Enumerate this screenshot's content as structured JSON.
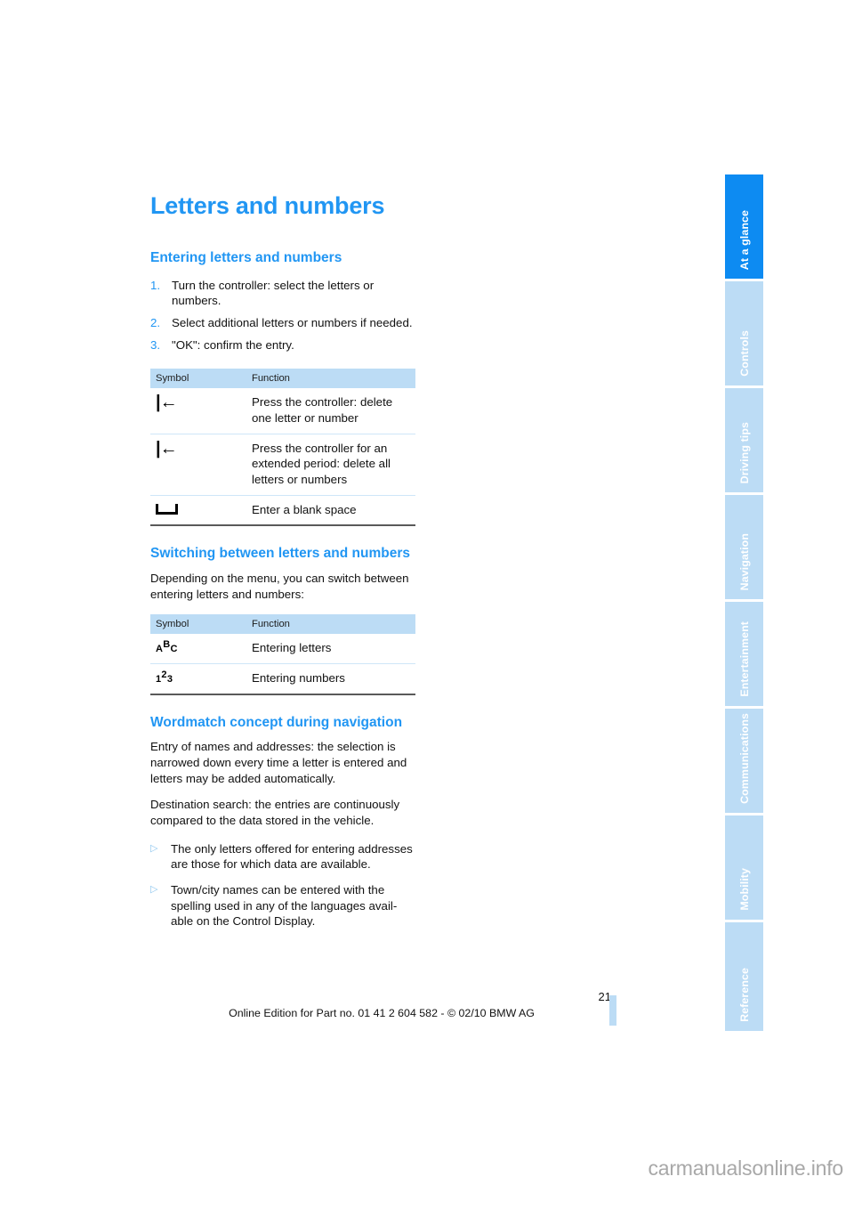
{
  "document": {
    "chapter_title": "Letters and numbers",
    "page_number": "21",
    "edition_line": "Online Edition for Part no. 01 41 2 604 582 - © 02/10 BMW AG",
    "watermark": "carmanualsonline.info",
    "accent_color": "#2196f3",
    "tab_active_color": "#0d8bf2",
    "tab_inactive_color": "#bcdcf5",
    "table_header_color": "#bcdcf5"
  },
  "section_entering": {
    "heading": "Entering letters and numbers",
    "steps": [
      {
        "num": "1.",
        "text": "Turn the controller: select the letters or numbers."
      },
      {
        "num": "2.",
        "text": "Select additional letters or numbers if needed."
      },
      {
        "num": "3.",
        "text": "\"OK\": confirm the entry."
      }
    ],
    "table": {
      "headers": {
        "symbol": "Symbol",
        "function": "Function"
      },
      "rows": [
        {
          "symbol_icon": "backspace-icon",
          "function": "Press the controller: delete one letter or number"
        },
        {
          "symbol_icon": "backspace-icon",
          "function": "Press the controller for an extended period: delete all letters or numbers"
        },
        {
          "symbol_icon": "blank-space-icon",
          "function": "Enter a blank space"
        }
      ]
    }
  },
  "section_switching": {
    "heading": "Switching between letters and numbers",
    "intro": "Depending on the menu, you can switch between entering letters and numbers:",
    "table": {
      "headers": {
        "symbol": "Symbol",
        "function": "Function"
      },
      "rows": [
        {
          "symbol_icon": "abc-icon",
          "symbol_text": "ABC",
          "function": "Entering letters"
        },
        {
          "symbol_icon": "123-icon",
          "symbol_text": "123",
          "function": "Entering numbers"
        }
      ]
    }
  },
  "section_wordmatch": {
    "heading": "Wordmatch concept during navigation",
    "paragraphs": [
      "Entry of names and addresses: the selection is narrowed down every time a letter is entered and letters may be added automatically.",
      "Destination search: the entries are continuously compared to the data stored in the vehicle."
    ],
    "bullets": [
      "The only letters offered for entering addresses are those for which data are available.",
      "Town/city names can be entered with the spelling used in any of the languages avail-able on the Control Display."
    ]
  },
  "rail": {
    "tabs": [
      {
        "label": "At a glance",
        "active": true
      },
      {
        "label": "Controls",
        "active": false
      },
      {
        "label": "Driving tips",
        "active": false
      },
      {
        "label": "Navigation",
        "active": false
      },
      {
        "label": "Entertainment",
        "active": false
      },
      {
        "label": "Communications",
        "active": false
      },
      {
        "label": "Mobility",
        "active": false
      },
      {
        "label": "Reference",
        "active": false
      }
    ]
  }
}
